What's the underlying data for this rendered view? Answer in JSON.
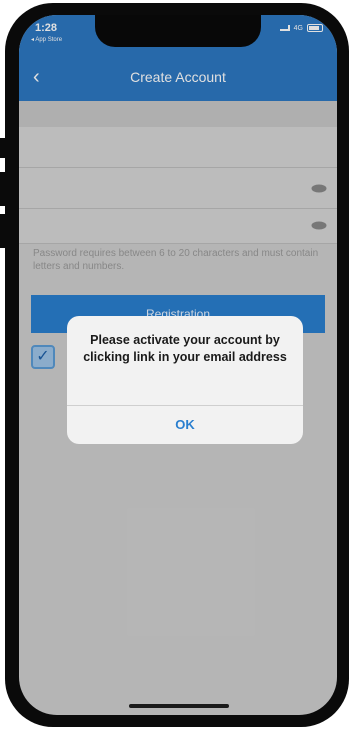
{
  "status_bar": {
    "time": "1:28",
    "back_app": "◂ App Store",
    "network": "4G"
  },
  "nav": {
    "title": "Create Account",
    "back_icon": "chevron-left-icon"
  },
  "form": {
    "password_hint": "Password requires between 6 to 20 characters and must contain letters and numbers.",
    "registration_label": "Registration",
    "terms_checked": true
  },
  "alert": {
    "message": "Please activate your account by clicking link in your email address",
    "ok_label": "OK"
  },
  "colors": {
    "accent": "#2d78c2",
    "button": "#2a7fcf",
    "alert_bg": "#f2f2f2"
  }
}
